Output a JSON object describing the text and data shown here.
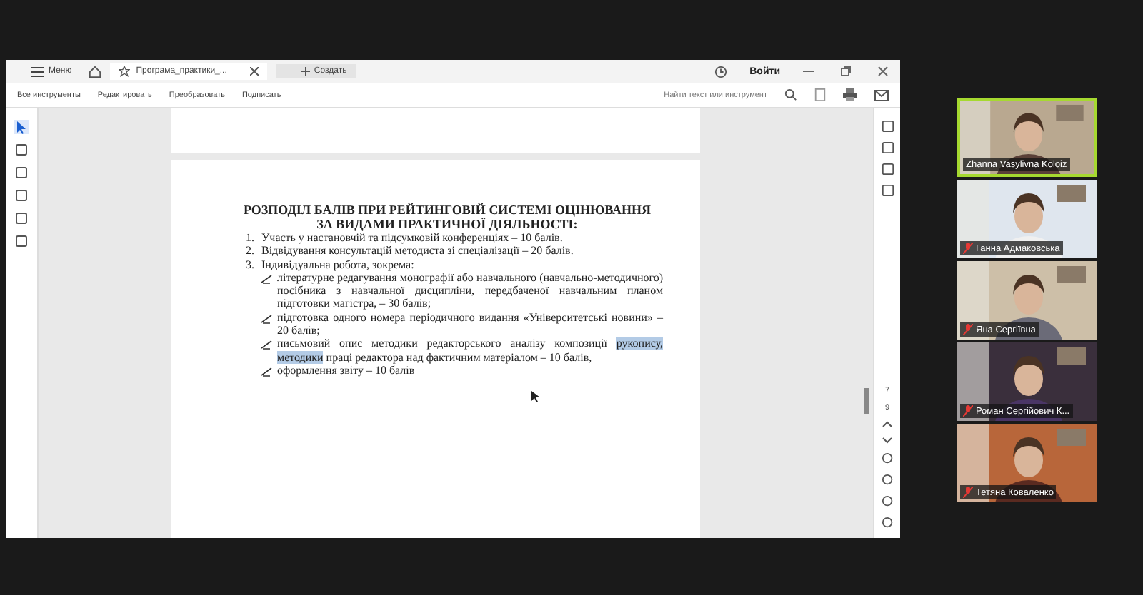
{
  "viewer": {
    "menu": "Меню",
    "tab": {
      "title": "Програма_практики_...",
      "selected": true
    },
    "new_tab": "Создать",
    "sign_in": "Войти",
    "toolbar": [
      "Все инструменты",
      "Редактировать",
      "Преобразовать",
      "Подписать"
    ],
    "search": {
      "placeholder": "Найти текст или инструмент"
    },
    "page_counter": [
      "7",
      "9"
    ]
  },
  "document": {
    "title": [
      "РОЗПОДІЛ БАЛІВ ПРИ РЕЙТИНГОВІЙ СИСТЕМІ ОЦІНЮВАННЯ",
      "ЗА ВИДАМИ ПРАКТИЧНОЇ ДІЯЛЬНОСТІ:"
    ],
    "items": [
      {
        "number": "1.",
        "text": "Участь у настановчій та підсумковій конференціях –  10 балів."
      },
      {
        "number": "2.",
        "text": "Відвідування консультацій методиста зі спеціалізації  – 20 балів."
      },
      {
        "number": "3.",
        "text": "Індивідуальна робота, зокрема:"
      }
    ],
    "subitems": [
      {
        "segments": [
          {
            "text": "літературне редагування монографії або навчального (навчально-методичного) посібника з навчальної дисципліни, передбаченої навчальним планом підготовки магістра, – 30 балів;",
            "highlighted": false
          }
        ]
      },
      {
        "segments": [
          {
            "text": "підготовка одного номера періодичного видання «Університетські новини» – 20 балів;",
            "highlighted": false
          }
        ]
      },
      {
        "segments": [
          {
            "text": "письмовий опис методики редакторського аналізу композиції ",
            "highlighted": false
          },
          {
            "text": "рукопису, методики",
            "highlighted": true
          },
          {
            "text": " праці редактора над фактичним матеріалом – 10 балів,",
            "highlighted": false
          }
        ]
      },
      {
        "segments": [
          {
            "text": "оформлення звіту – 10 балів",
            "highlighted": false
          }
        ]
      }
    ]
  },
  "participants": [
    {
      "name": "Zhanna Vasylivna Koloiz",
      "active": true,
      "muted": false,
      "kind": "picture"
    },
    {
      "name": "Ганна Адмаковська",
      "active": false,
      "muted": true,
      "kind": "picture"
    },
    {
      "name": "Яна Сергіївна",
      "active": false,
      "muted": true,
      "kind": "picture"
    },
    {
      "name": "Роман Сергійович К...",
      "active": false,
      "muted": true,
      "kind": "picture"
    },
    {
      "name": "Тетяна Коваленко",
      "active": false,
      "muted": true,
      "kind": "picture"
    }
  ]
}
